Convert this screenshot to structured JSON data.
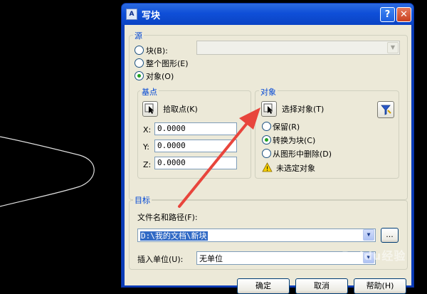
{
  "dialog": {
    "title": "写块",
    "help_symbol": "?",
    "close_symbol": "✕"
  },
  "source": {
    "legend": "源",
    "block_label": "块(B):",
    "entire_drawing_label": "整个图形(E)",
    "objects_label": "对象(O)",
    "selected": "objects"
  },
  "base_point": {
    "legend": "基点",
    "pick_label": "拾取点(K)",
    "x_label": "X:",
    "x_value": "0.0000",
    "y_label": "Y:",
    "y_value": "0.0000",
    "z_label": "Z:",
    "z_value": "0.0000"
  },
  "objects": {
    "legend": "对象",
    "select_label": "选择对象(T)",
    "retain_label": "保留(R)",
    "convert_label": "转换为块(C)",
    "delete_label": "从图形中删除(D)",
    "selected": "convert",
    "warning_text": "未选定对象",
    "warning_symbol": "!"
  },
  "destination": {
    "legend": "目标",
    "path_label": "文件名和路径(F):",
    "path_value": "D:\\我的文档\\新块",
    "browse_label": "...",
    "units_label": "插入单位(U):",
    "units_value": "无单位"
  },
  "buttons": {
    "ok": "确定",
    "cancel": "取消",
    "help": "帮助(H)"
  },
  "watermark": "Baidu经验",
  "colors": {
    "titlebar": "#0f4fd8",
    "client": "#ece9d8",
    "legend": "#0046d5",
    "arrow": "#e8453c"
  }
}
